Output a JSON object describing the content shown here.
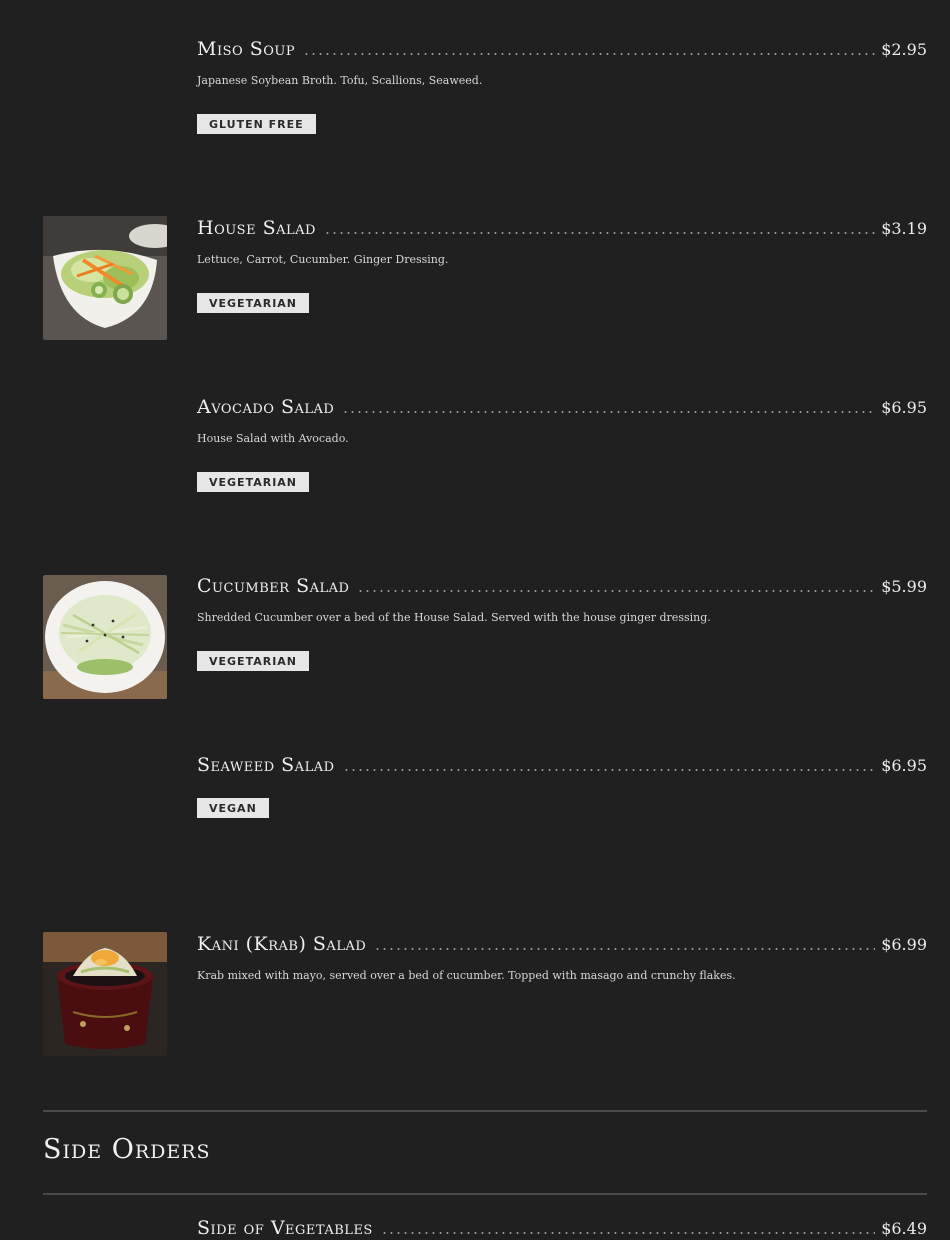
{
  "items": [
    {
      "name": "Miso Soup",
      "price": "$2.95",
      "description": "Japanese Soybean Broth. Tofu, Scallions, Seaweed.",
      "badge": "GLUTEN FREE",
      "has_photo": false
    },
    {
      "name": "House Salad",
      "price": "$3.19",
      "description": "Lettuce, Carrot, Cucumber. Ginger Dressing.",
      "badge": "VEGETARIAN",
      "has_photo": true
    },
    {
      "name": "Avocado Salad",
      "price": "$6.95",
      "description": "House Salad with Avocado.",
      "badge": "VEGETARIAN",
      "has_photo": false
    },
    {
      "name": "Cucumber Salad",
      "price": "$5.99",
      "description": "Shredded Cucumber over a bed of the House Salad. Served with the house ginger dressing.",
      "badge": "VEGETARIAN",
      "has_photo": true
    },
    {
      "name": "Seaweed Salad",
      "price": "$6.95",
      "description": "",
      "badge": "VEGAN",
      "has_photo": false
    },
    {
      "name": "Kani (Krab) Salad",
      "price": "$6.99",
      "description": "Krab mixed with mayo, served over a bed of cucumber. Topped with masago and crunchy flakes.",
      "badge": "",
      "has_photo": true
    }
  ],
  "side_orders": {
    "title": "Side Orders",
    "items": [
      {
        "name": "Side of Vegetables",
        "price": "$6.49"
      }
    ]
  }
}
